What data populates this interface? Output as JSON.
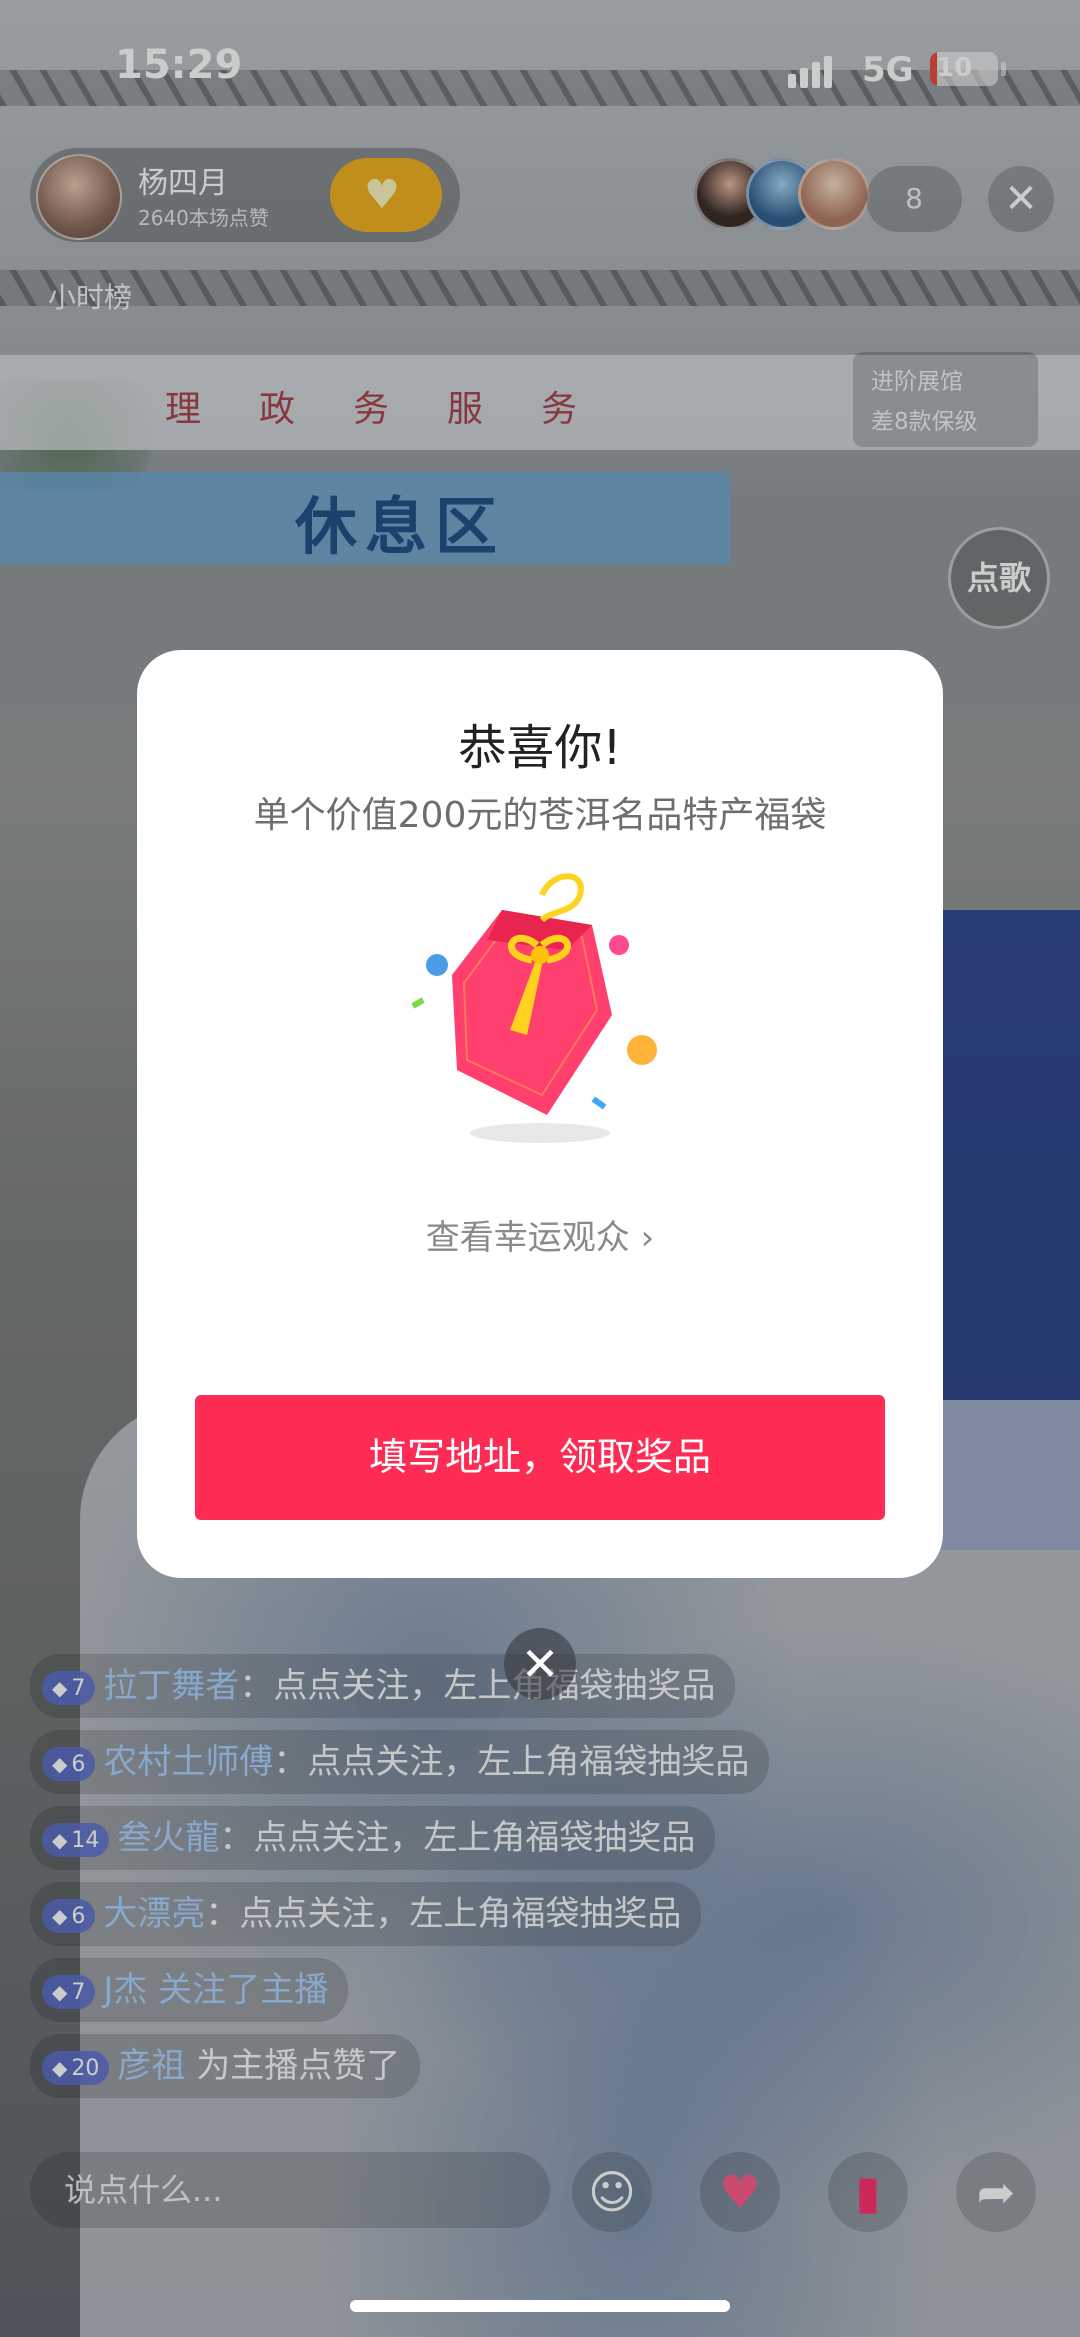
{
  "status_bar": {
    "time": "15:29",
    "network": "5G",
    "battery": "10",
    "battery_level": 0.1
  },
  "host": {
    "name": "杨四月",
    "likes": "2640本场点赞"
  },
  "viewer_count": "8",
  "hour_rank": "小时榜",
  "exhibition": {
    "line1": "进阶展馆",
    "line2": "差8款保级"
  },
  "song_button": "点歌",
  "background_signs": {
    "top": "理政务服务",
    "rest_area": "休息区"
  },
  "modal": {
    "title": "恭喜你!",
    "subtitle": "单个价值200元的苍洱名品特产福袋",
    "see_lucky": "查看幸运观众 ›",
    "claim_button": "填写地址，领取奖品"
  },
  "chat": [
    {
      "level": "7",
      "user": "拉丁舞者",
      "sep": "：",
      "text": "点点关注，左上角福袋抽奖品"
    },
    {
      "level": "6",
      "user": "农村土师傅",
      "sep": "：",
      "text": "点点关注，左上角福袋抽奖品"
    },
    {
      "level": "14",
      "user": "叁火龍",
      "sep": "：",
      "text": "点点关注，左上角福袋抽奖品"
    },
    {
      "level": "6",
      "user": "大漂亮",
      "sep": "：",
      "text": "点点关注，左上角福袋抽奖品"
    },
    {
      "level": "7",
      "user": "J杰",
      "sep": " ",
      "text": "关注了主播"
    },
    {
      "level": "20",
      "user": "彦祖",
      "sep": " ",
      "text": "为主播点赞了"
    }
  ],
  "input": {
    "placeholder": "说点什么..."
  },
  "icons": {
    "emoji": "emoji-icon",
    "heart": "heart-gift-icon",
    "gift": "gift-icon",
    "share": "share-icon"
  },
  "colors": {
    "accent": "#fe2c55",
    "follow": "#f2b01e"
  }
}
